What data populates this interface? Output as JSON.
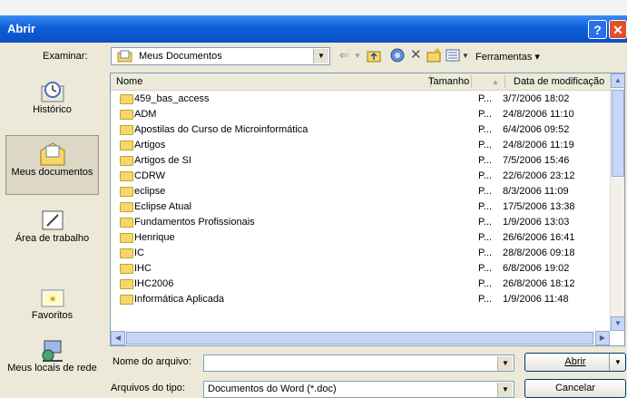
{
  "window": {
    "title": "Abrir",
    "help_symbol": "?",
    "close_symbol": "✕"
  },
  "lookin": {
    "label": "Examinar:",
    "value": "Meus Documentos"
  },
  "toolbar": {
    "back_icon": "back-arrow-icon",
    "up_icon": "up-folder-icon",
    "search_icon": "search-web-icon",
    "delete_icon": "delete-icon",
    "newfolder_icon": "new-folder-icon",
    "views_icon": "views-icon",
    "tools_label": "Ferramentas"
  },
  "places": [
    {
      "label": "Histórico",
      "icon": "history-icon"
    },
    {
      "label": "Meus documentos",
      "icon": "my-documents-icon"
    },
    {
      "label": "Área de trabalho",
      "icon": "desktop-icon"
    },
    {
      "label": "Favoritos",
      "icon": "favorites-icon"
    },
    {
      "label": "Meus locais de rede",
      "icon": "network-places-icon"
    }
  ],
  "columns": {
    "name": "Nome",
    "size": "Tamanho",
    "date": "Data de modificação"
  },
  "files": [
    {
      "name": "459_bas_access",
      "type": "P...",
      "date": "3/7/2006 18:02"
    },
    {
      "name": "ADM",
      "type": "P...",
      "date": "24/8/2006 11:10"
    },
    {
      "name": "Apostilas do Curso de Microinformática",
      "type": "P...",
      "date": "6/4/2006 09:52"
    },
    {
      "name": "Artigos",
      "type": "P...",
      "date": "24/8/2006 11:19"
    },
    {
      "name": "Artigos de SI",
      "type": "P...",
      "date": "7/5/2006 15:46"
    },
    {
      "name": "CDRW",
      "type": "P...",
      "date": "22/6/2006 23:12"
    },
    {
      "name": "eclipse",
      "type": "P...",
      "date": "8/3/2006 11:09"
    },
    {
      "name": "Eclipse Atual",
      "type": "P...",
      "date": "17/5/2006 13:38"
    },
    {
      "name": "Fundamentos Profissionais",
      "type": "P...",
      "date": "1/9/2006 13:03"
    },
    {
      "name": "Henrique",
      "type": "P...",
      "date": "26/6/2006 16:41"
    },
    {
      "name": "IC",
      "type": "P...",
      "date": "28/8/2006 09:18"
    },
    {
      "name": "IHC",
      "type": "P...",
      "date": "6/8/2006 19:02"
    },
    {
      "name": "IHC2006",
      "type": "P...",
      "date": "26/8/2006 18:12"
    },
    {
      "name": "Informática Aplicada",
      "type": "P...",
      "date": "1/9/2006 11:48"
    }
  ],
  "filename": {
    "label": "Nome do arquivo:",
    "value": ""
  },
  "filetype": {
    "label": "Arquivos do tipo:",
    "value": "Documentos do Word (*.doc)"
  },
  "buttons": {
    "open": "Abrir",
    "cancel": "Cancelar"
  }
}
